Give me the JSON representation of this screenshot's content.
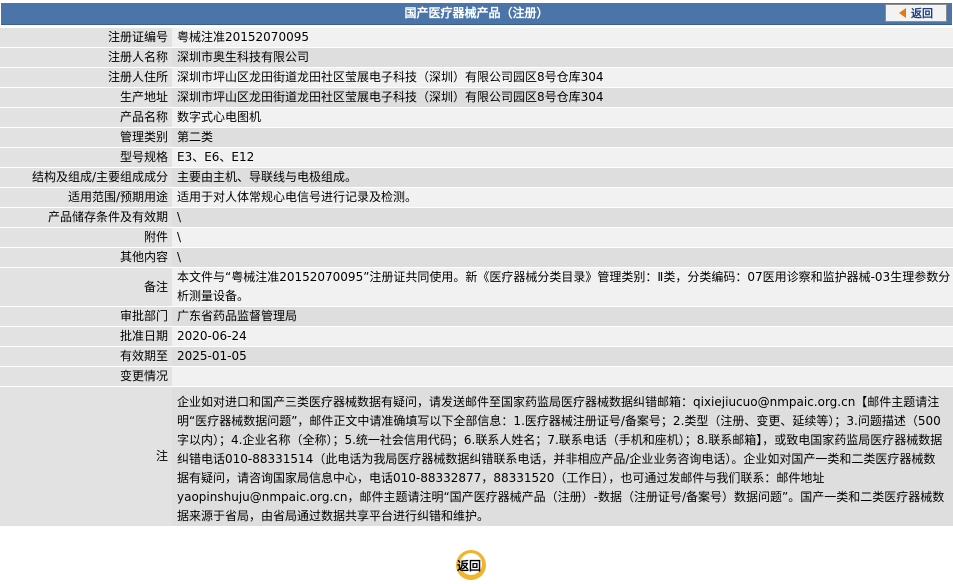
{
  "header": {
    "title": "国产医疗器械产品（注册）",
    "back_label": "返回"
  },
  "rows": [
    {
      "label": "注册证编号",
      "value": "粤械注准20152070095"
    },
    {
      "label": "注册人名称",
      "value": "深圳市奥生科技有限公司"
    },
    {
      "label": "注册人住所",
      "value": "深圳市坪山区龙田街道龙田社区莹展电子科技（深圳）有限公司园区8号仓库304"
    },
    {
      "label": "生产地址",
      "value": "深圳市坪山区龙田街道龙田社区莹展电子科技（深圳）有限公司园区8号仓库304"
    },
    {
      "label": "产品名称",
      "value": "数字式心电图机"
    },
    {
      "label": "管理类别",
      "value": "第二类"
    },
    {
      "label": "型号规格",
      "value": "E3、E6、E12"
    },
    {
      "label": "结构及组成/主要组成成分",
      "value": "主要由主机、导联线与电极组成。"
    },
    {
      "label": "适用范围/预期用途",
      "value": "适用于对人体常规心电信号进行记录及检测。"
    },
    {
      "label": "产品储存条件及有效期",
      "value": "\\"
    },
    {
      "label": "附件",
      "value": "\\"
    },
    {
      "label": "其他内容",
      "value": "\\"
    },
    {
      "label": "备注",
      "value": "本文件与“粤械注准20152070095”注册证共同使用。新《医疗器械分类目录》管理类别：Ⅱ类，分类编码：07医用诊察和监护器械-03生理参数分析测量设备。"
    },
    {
      "label": "审批部门",
      "value": "广东省药品监督管理局"
    },
    {
      "label": "批准日期",
      "value": "2020-06-24"
    },
    {
      "label": "有效期至",
      "value": "2025-01-05"
    },
    {
      "label": "变更情况",
      "value": ""
    }
  ],
  "note": {
    "label": "注",
    "text": "企业如对进口和国产三类医疗器械数据有疑问，请发送邮件至国家药监局医疗器械数据纠错邮箱：qixiejiucuo@nmpaic.org.cn【邮件主题请注明“医疗器械数据问题”，邮件正文中请准确填写以下全部信息：1.医疗器械注册证号/备案号；2.类型（注册、变更、延续等）；3.问题描述（500字以内）；4.企业名称（全称）；5.统一社会信用代码；6.联系人姓名；7.联系电话（手机和座机）；8.联系邮箱】，或致电国家药监局医疗器械数据纠错电话010-88331514（此电话为我局医疗器械数据纠错联系电话，并非相应产品/企业业务咨询电话）。企业如对国产一类和二类医疗器械数据有疑问，请咨询国家局信息中心，电话010-88332877，88331520（工作日），也可通过发邮件与我们联系：邮件地址yaopinshuju@nmpaic.org.cn，邮件主题请注明“国产医疗器械产品（注册）-数据（注册证号/备案号）数据问题”。国产一类和二类医疗器械数据来源于省局，由省局通过数据共享平台进行纠错和维护。"
  },
  "footer": {
    "back_label": "返回"
  }
}
